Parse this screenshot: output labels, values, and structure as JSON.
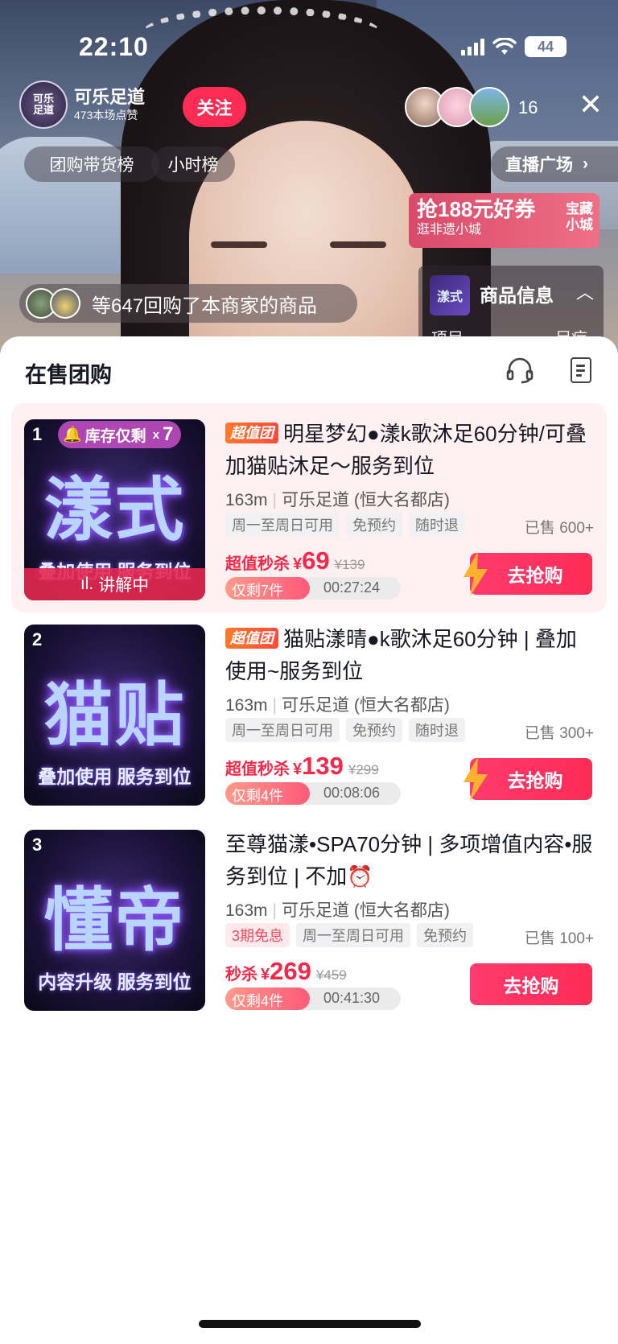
{
  "status": {
    "time": "22:10",
    "battery": "44"
  },
  "host": {
    "avatar_text": "可乐\n足道",
    "name": "可乐足道",
    "likes": "473本场点赞",
    "follow_label": "关注",
    "viewer_count": "16"
  },
  "ranks": {
    "group_rank": "团购带货榜",
    "hour_rank": "小时榜",
    "live_square": "直播广场"
  },
  "coupon": {
    "main": "抢188元好券",
    "sub": "逛非遗小城",
    "side": "宝藏\n小城"
  },
  "buyers": {
    "text": "等647回购了本商家的商品"
  },
  "goods_info": {
    "icon_text": "漾式",
    "title": "商品信息",
    "col1": "项目",
    "col2": "足疗"
  },
  "panel": {
    "title": "在售团购"
  },
  "products": [
    {
      "rank": "1",
      "thumb_main": "漾式",
      "thumb_sub": "叠加使用 服务到位",
      "stock_tag": "库存仅剩",
      "stock_x": "x",
      "stock_n": "7",
      "explaining": "讲解中",
      "tag": "超值团",
      "title": "明星梦幻●漾k歌沐足60分钟/可叠加猫贴沐足～服务到位",
      "distance": "163m",
      "shop": "可乐足道 (恒大名都店)",
      "chips": [
        "周一至周日可用",
        "免预约",
        "随时退"
      ],
      "sold": "已售 600+",
      "price_label": "超值秒杀",
      "price_yen": "¥",
      "price_now": "69",
      "price_old": "¥139",
      "remain": "仅剩7件",
      "remain_fraction": 0.48,
      "countdown": "00:27:24",
      "buy_label": "去抢购"
    },
    {
      "rank": "2",
      "thumb_main": "猫贴",
      "thumb_sub": "叠加使用 服务到位",
      "tag": "超值团",
      "title": "猫贴漾晴●k歌沐足60分钟 | 叠加使用~服务到位",
      "distance": "163m",
      "shop": "可乐足道 (恒大名都店)",
      "chips": [
        "周一至周日可用",
        "免预约",
        "随时退"
      ],
      "sold": "已售 300+",
      "price_label": "超值秒杀",
      "price_yen": "¥",
      "price_now": "139",
      "price_old": "¥299",
      "remain": "仅剩4件",
      "remain_fraction": 0.48,
      "countdown": "00:08:06",
      "buy_label": "去抢购"
    },
    {
      "rank": "3",
      "thumb_main": "懂帝",
      "thumb_sub": "内容升级 服务到位",
      "title": "至尊猫漾•SPA70分钟 | 多项增值内容•服务到位 | 不加⏰",
      "distance": "163m",
      "shop": "可乐足道 (恒大名都店)",
      "chips": [
        "3期免息",
        "周一至周日可用",
        "免预约"
      ],
      "sold": "已售 100+",
      "price_label": "秒杀",
      "price_yen": "¥",
      "price_now": "269",
      "price_old": "¥459",
      "remain": "仅剩4件",
      "remain_fraction": 0.48,
      "countdown": "00:41:30",
      "buy_label": "去抢购"
    }
  ],
  "colors": {
    "accent": "#fe2c55",
    "price": "#f6284a",
    "active_row": "#fff0f2"
  }
}
